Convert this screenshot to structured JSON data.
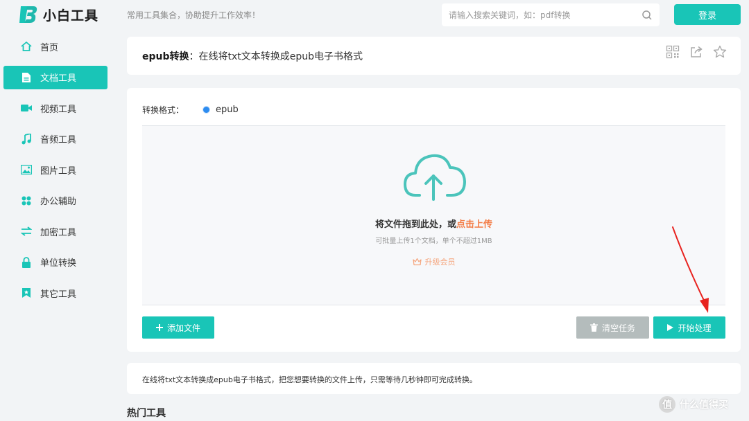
{
  "brand": {
    "name": "小白工具",
    "slogan": "常用工具集合，协助提升工作效率！"
  },
  "search": {
    "placeholder": "请输入搜索关键词，如：pdf转换"
  },
  "header": {
    "login_label": "登录"
  },
  "sidebar": {
    "items": [
      {
        "label": "首页",
        "icon": "home-icon"
      },
      {
        "label": "文档工具",
        "icon": "document-icon",
        "active": true
      },
      {
        "label": "视频工具",
        "icon": "video-icon"
      },
      {
        "label": "音频工具",
        "icon": "music-icon"
      },
      {
        "label": "图片工具",
        "icon": "image-icon"
      },
      {
        "label": "办公辅助",
        "icon": "apps-icon"
      },
      {
        "label": "加密工具",
        "icon": "swap-icon"
      },
      {
        "label": "单位转换",
        "icon": "lock-icon"
      },
      {
        "label": "其它工具",
        "icon": "bookmark-icon"
      }
    ]
  },
  "page": {
    "title_bold": "epub转换",
    "title_rest": "：在线将txt文本转换成epub电子书格式",
    "actions": [
      "qrcode-icon",
      "share-icon",
      "star-icon"
    ]
  },
  "converter": {
    "format_label": "转换格式：",
    "format_value": "epub",
    "drop_text": "将文件拖到此处，或",
    "drop_link": "点击上传",
    "drop_sub": "可批量上传1个文档，单个不超过1MB",
    "upgrade_label": "升级会员",
    "add_label": "添加文件",
    "clear_label": "清空任务",
    "start_label": "开始处理"
  },
  "info": {
    "text": "在线将txt文本转换成epub电子书格式，把您想要转换的文件上传，只需等待几秒钟即可完成转换。"
  },
  "hot_tools": {
    "title": "热门工具"
  },
  "watermark": {
    "text": "什么值得买"
  },
  "colors": {
    "accent": "#19c5b7",
    "link": "#f37b44",
    "clear_button": "#b4bcbc",
    "annotation": "#e8231f"
  }
}
